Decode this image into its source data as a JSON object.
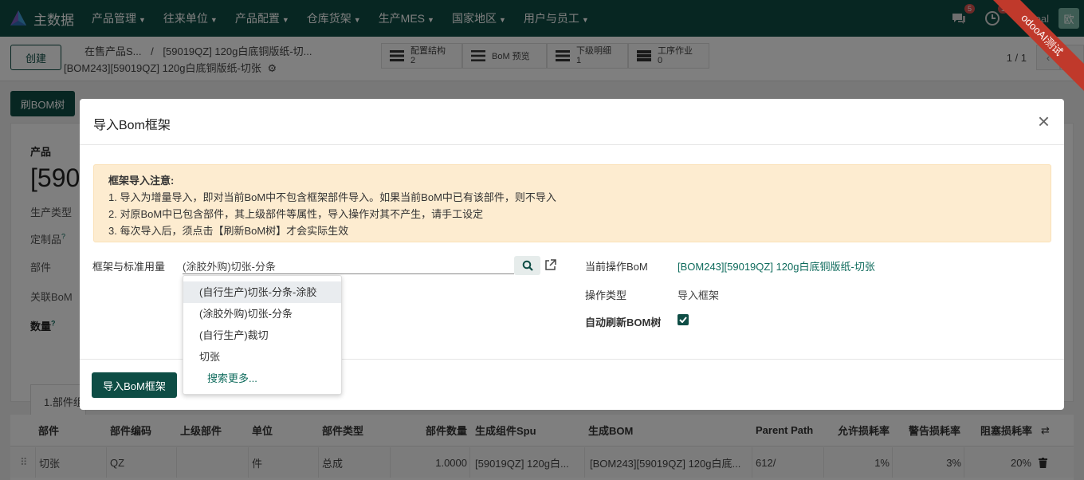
{
  "app": {
    "name": "主数据",
    "db": "odooal"
  },
  "menu": [
    "产品管理",
    "往来单位",
    "产品配置",
    "仓库货架",
    "生产MES",
    "国家地区",
    "用户与员工"
  ],
  "systray": {
    "chat_count": "5",
    "activity_count": "1",
    "avatar_text": "欧"
  },
  "ribbon": "odooAI测试",
  "control": {
    "create_label": "创建",
    "breadcrumb_parent": "在售产品S...",
    "breadcrumb_sep": "/",
    "breadcrumb_mid": "[59019QZ] 120g白底铜版纸-切...",
    "record_title": "[BOM243][59019QZ] 120g白底铜版纸-切张",
    "pager": "1 / 1"
  },
  "stat_buttons": [
    {
      "label": "配置结构",
      "value": "2"
    },
    {
      "label": "BoM 预览",
      "value": ""
    },
    {
      "label": "下级明细",
      "value": "1"
    },
    {
      "label": "工序作业",
      "value": "0"
    }
  ],
  "form_bg": {
    "refresh_button": "刷BOM树",
    "product_label": "产品",
    "product_value": "[590",
    "prod_type_label": "生产类型",
    "finished_label": "定制品",
    "finished_help": "?",
    "part_label": "部件",
    "related_bom_label": "关联BoM",
    "qty_label": "数量",
    "qty_help": "?",
    "tab_label": "1.部件组"
  },
  "table": {
    "headers": [
      "部件",
      "部件编码",
      "上级部件",
      "单位",
      "部件类型",
      "部件数量",
      "生成组件Spu",
      "生成BOM",
      "Parent Path",
      "允许损耗率",
      "警告损耗率",
      "阻塞损耗率"
    ],
    "row": [
      "切张",
      "QZ",
      "",
      "件",
      "总成",
      "1.0000",
      "[59019QZ] 120g白...",
      "[BOM243][59019QZ] 120g白底...",
      "612/",
      "1%",
      "3%",
      "20%"
    ]
  },
  "modal": {
    "title": "导入Bom框架",
    "close": "×",
    "alert": {
      "title": "框架导入注意:",
      "lines": [
        "1. 导入为增量导入，即对当前BoM中不包含框架部件导入。如果当前BoM中已有该部件，则不导入",
        "2. 对原BoM中已包含部件，其上级部件等属性，导入操作对其不产生，请手工设定",
        "3. 每次导入后，须点击【刷新BoM树】才会实际生效"
      ]
    },
    "framework_label": "框架与标准用量",
    "framework_value": "(涂胶外购)切张-分条",
    "current_bom_label": "当前操作BoM",
    "current_bom_value": "[BOM243][59019QZ] 120g白底铜版纸-切张",
    "op_type_label": "操作类型",
    "op_type_value": "导入框架",
    "auto_refresh_label": "自动刷新BOM树",
    "auto_refresh_checked": true,
    "import_button": "导入BoM框架"
  },
  "dropdown": {
    "items": [
      "(自行生产)切张-分条-涂胶",
      "(涂胶外购)切张-分条",
      "(自行生产)裁切",
      "切张"
    ],
    "more": "搜索更多..."
  }
}
